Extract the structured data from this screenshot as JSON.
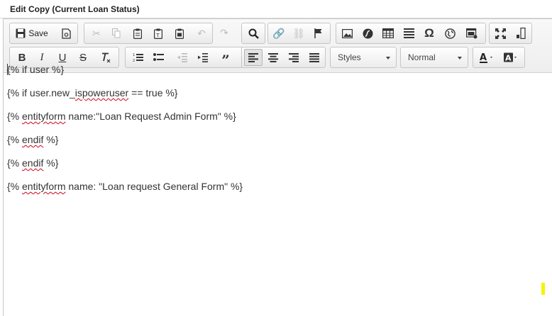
{
  "title": "Edit Copy (Current Loan Status)",
  "toolbar": {
    "save_label": "Save",
    "styles_label": "Styles",
    "format_label": "Normal"
  },
  "content_lines": [
    {
      "pre": "{% if user %}",
      "sq": "",
      "post": ""
    },
    {
      "pre": "{% if user.new_",
      "sq": "ispoweruser",
      "post": " == true %}"
    },
    {
      "pre": "{% ",
      "sq": "entityform",
      "post": " name:\"Loan Request Admin Form\" %}"
    },
    {
      "pre": "{% ",
      "sq": "endif",
      "post": " %}"
    },
    {
      "pre": "{% ",
      "sq": "endif",
      "post": " %}"
    },
    {
      "pre": "{% ",
      "sq": "entityform",
      "post": " name: \"Loan request General Form\" %}"
    }
  ],
  "colors": {
    "highlight": "#f4f400",
    "spellcheck": "#d0021b"
  }
}
